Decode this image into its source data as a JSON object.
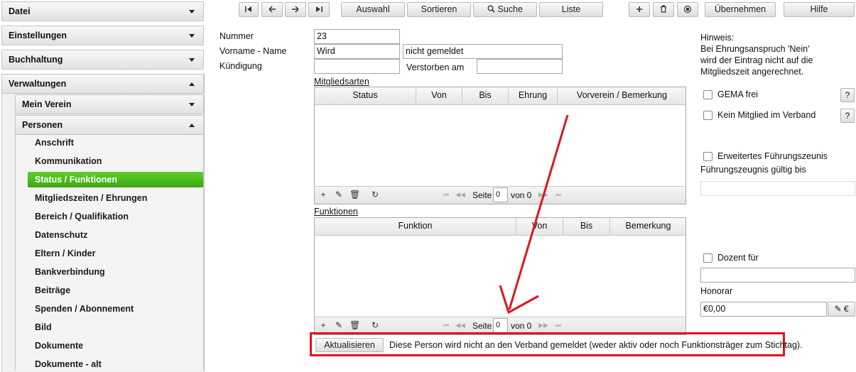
{
  "sidebar": {
    "sections": [
      {
        "label": "Datei"
      },
      {
        "label": "Einstellungen"
      },
      {
        "label": "Buchhaltung"
      },
      {
        "label": "Verwaltungen"
      }
    ],
    "subsections": [
      {
        "label": "Mein Verein"
      },
      {
        "label": "Personen"
      }
    ],
    "items": [
      {
        "label": "Anschrift"
      },
      {
        "label": "Kommunikation"
      },
      {
        "label": "Status / Funktionen"
      },
      {
        "label": "Mitgliedszeiten / Ehrungen"
      },
      {
        "label": "Bereich / Qualifikation"
      },
      {
        "label": "Datenschutz"
      },
      {
        "label": "Eltern / Kinder"
      },
      {
        "label": "Bankverbindung"
      },
      {
        "label": "Beiträge"
      },
      {
        "label": "Spenden / Abonnement"
      },
      {
        "label": "Bild"
      },
      {
        "label": "Dokumente"
      },
      {
        "label": "Dokumente - alt"
      }
    ]
  },
  "toolbar": {
    "auswahl": "Auswahl",
    "sortieren": "Sortieren",
    "suche": "Suche",
    "liste": "Liste",
    "uebernehmen": "Übernehmen",
    "hilfe": "Hilfe"
  },
  "form": {
    "nummer_label": "Nummer",
    "nummer_value": "23",
    "vorname_label": "Vorname - Name",
    "vorname_value": "Wird",
    "nachname_value": "nicht gemeldet",
    "kuendigung_label": "Kündigung",
    "kuendigung_value": "",
    "verstorben_label": "Verstorben am",
    "verstorben_value": ""
  },
  "mitgliedsarten": {
    "title": "Mitgliedsarten",
    "columns": [
      "Status",
      "Von",
      "Bis",
      "Ehrung",
      "Vorverein / Bemerkung"
    ],
    "page_label": "Seite",
    "page_value": "0",
    "of_label": "von 0"
  },
  "funktionen": {
    "title": "Funktionen",
    "columns": [
      "Funktion",
      "Von",
      "Bis",
      "Bemerkung"
    ],
    "page_label": "Seite",
    "page_value": "0",
    "of_label": "von 0"
  },
  "status_bar": {
    "aktualisieren": "Aktualisieren",
    "message": "Diese Person wird nicht an den Verband gemeldet (weder aktiv oder noch Funktionsträger zum Stichtag)."
  },
  "right": {
    "hinweis_title": "Hinweis:",
    "hinweis_line1": "Bei Ehrungsanspruch 'Nein'",
    "hinweis_line2": "wird der Eintrag nicht auf die",
    "hinweis_line3": "Mitgliedszeit angerechnet.",
    "gema_label": "GEMA frei",
    "kein_mitglied_label": "Kein Mitglied im Verband",
    "help_q": "?",
    "fuehrung_label": "Erweitertes Führungszeunis",
    "fuehrung_gueltig_label": "Führungszeugnis gültig bis",
    "fuehrung_gueltig_value": "",
    "dozent_label": "Dozent für",
    "dozent_value": "",
    "honorar_label": "Honorar",
    "honorar_value": "€0,00",
    "euro_symbol": "€"
  },
  "colors": {
    "active_green": "#4bb81c",
    "annotation_red": "#e0141e"
  },
  "icons": [
    "first-record-icon",
    "prev-record-icon",
    "next-record-icon",
    "last-record-icon",
    "search-icon",
    "add-icon",
    "delete-icon",
    "copy-icon",
    "edit-icon",
    "refresh-icon"
  ]
}
